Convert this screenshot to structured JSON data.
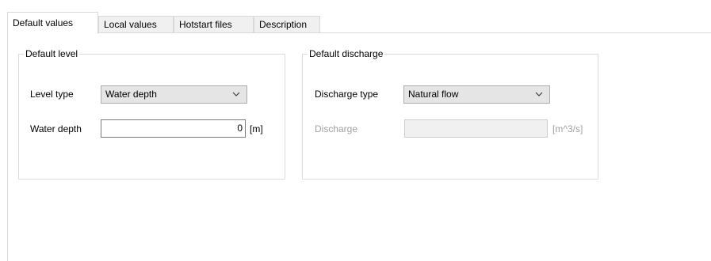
{
  "tabs": [
    {
      "label": "Default values",
      "active": true
    },
    {
      "label": "Local values",
      "active": false
    },
    {
      "label": "Hotstart files",
      "active": false
    },
    {
      "label": "Description",
      "active": false
    }
  ],
  "default_level": {
    "title": "Default level",
    "level_type_label": "Level type",
    "level_type_value": "Water depth",
    "water_depth_label": "Water depth",
    "water_depth_value": "0",
    "water_depth_unit": "[m]"
  },
  "default_discharge": {
    "title": "Default discharge",
    "discharge_type_label": "Discharge type",
    "discharge_type_value": "Natural flow",
    "discharge_label": "Discharge",
    "discharge_value": "",
    "discharge_unit": "[m^3/s]",
    "discharge_enabled": false
  },
  "icons": {
    "dropdown": "chevron-down-icon"
  },
  "colors": {
    "tab_active_bg": "#ffffff",
    "tab_inactive_bg": "#f0f0f0",
    "border": "#d9d9d9",
    "combo_bg": "#e5e5e5",
    "disabled_text": "#a0a0a0"
  }
}
